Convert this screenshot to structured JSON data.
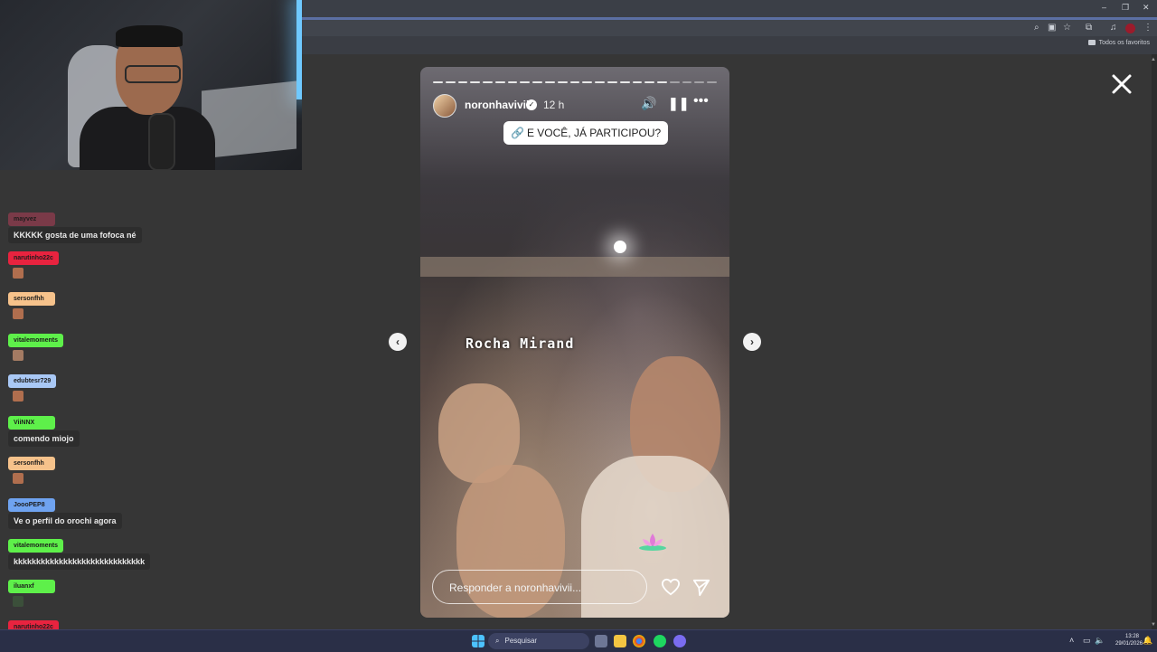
{
  "browser": {
    "bookmarks_folder": "Todos os favoritos"
  },
  "chat": {
    "messages": [
      {
        "user": "mayvez",
        "color": "#7a3a48",
        "text": "KKKKK gosta de uma fofoca né"
      },
      {
        "user": "narutinho22c",
        "color": "#e8233f",
        "emote": "face-emote"
      },
      {
        "user": "sersonfhh",
        "color": "#f6c28b",
        "emote": "face-emote"
      },
      {
        "user": "vitalemoments",
        "color": "#5ef04a",
        "emote": "person-emote"
      },
      {
        "user": "edubtesr729",
        "color": "#a9c8f5",
        "emote": "face-emote"
      },
      {
        "user": "ViiNNX",
        "color": "#5ef04a",
        "text": "comendo miojo"
      },
      {
        "user": "sersonfhh",
        "color": "#f6c28b",
        "emote": "face-emote"
      },
      {
        "user": "JoooPEP8",
        "color": "#6fa3f0",
        "text": "Ve o perfil do orochi agora"
      },
      {
        "user": "vitalemoments",
        "color": "#5ef04a",
        "text": "kkkkkkkkkkkkkkkkkkkkkkkkkkkkk"
      },
      {
        "user": "iluanxf",
        "color": "#5ef04a",
        "emote": "green-emote"
      },
      {
        "user": "narutinho22c",
        "color": "#e8233f",
        "emote": "face-emote"
      }
    ]
  },
  "story": {
    "username": "noronhavivii",
    "time": "12 h",
    "link_sticker": "E VOCÊ, JÁ PARTICIPOU?",
    "location_text": "Rocha Mirand",
    "reply_placeholder": "Responder a noronhavivii...",
    "progress_segments": 23,
    "progress_done": 19
  },
  "taskbar": {
    "search_label": "Pesquisar",
    "time": "13:28",
    "date": "29/01/2026"
  },
  "colors": {
    "page_bg": "#363636",
    "taskbar_bg": "#2a2f47"
  }
}
